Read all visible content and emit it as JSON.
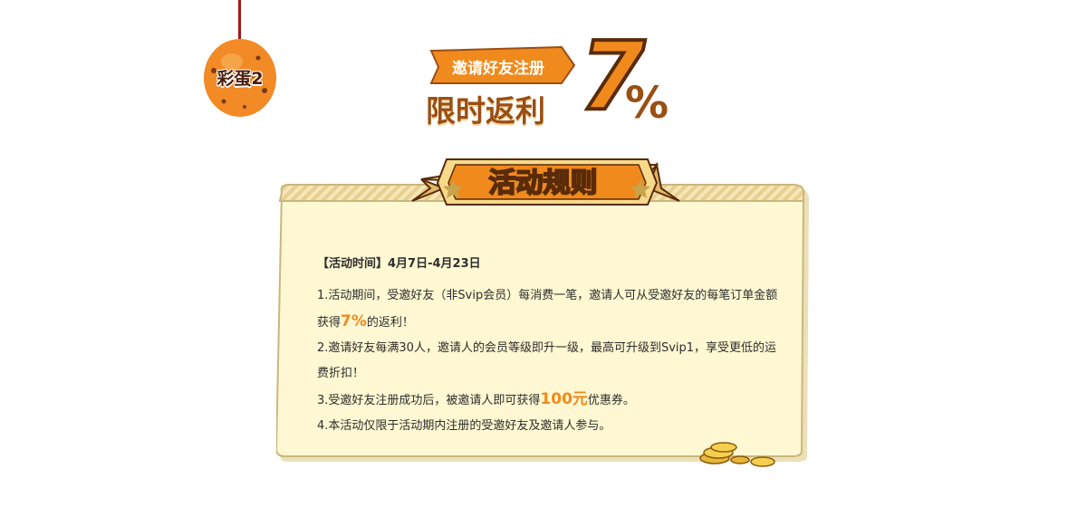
{
  "egg": {
    "label": "彩蛋2"
  },
  "promo": {
    "tag": "邀请好友注册",
    "headline": "限时返利",
    "big_number": "7",
    "percent": "%"
  },
  "rules_board": {
    "banner": "活动规则",
    "time_line": "【活动时间】4月7日-4月23日",
    "rule1_before": "1.活动期间，受邀好友（非Svip会员）每消费一笔，邀请人可从受邀好友的每笔订单金额获得",
    "rule1_highlight": "7%",
    "rule1_after": "的返利！",
    "rule2": "2.邀请好友每满30人，邀请人的会员等级即升一级，最高可升级到Svip1，享受更低的运费折扣！",
    "rule3_before": "3.受邀好友注册成功后，被邀请人即可获得",
    "rule3_highlight": "100元",
    "rule3_after": "优惠券。",
    "rule4": "4.本活动仅限于活动期内注册的受邀好友及邀请人参与。"
  },
  "colors": {
    "orange": "#f08a1d",
    "brown": "#9a4f13",
    "dark_brown": "#5a2b09",
    "paper": "#fff8d2"
  }
}
